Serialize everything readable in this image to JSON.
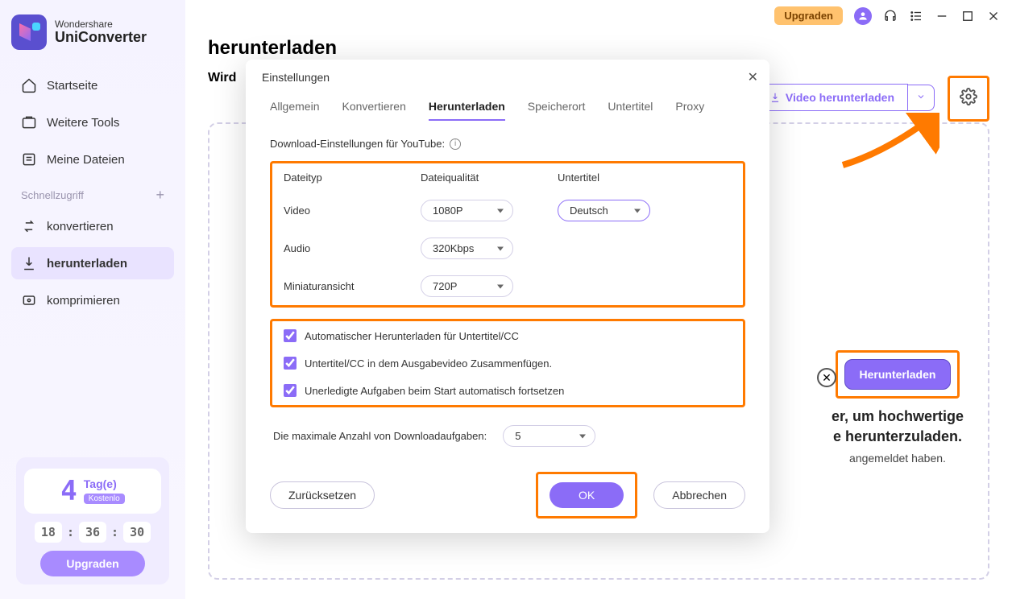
{
  "titlebar": {
    "upgrade": "Upgraden"
  },
  "brand": {
    "top": "Wondershare",
    "bottom": "UniConverter"
  },
  "nav": {
    "home": "Startseite",
    "tools": "Weitere Tools",
    "files": "Meine Dateien",
    "quick_label": "Schnellzugriff",
    "convert": "konvertieren",
    "download": "herunterladen",
    "compress": "komprimieren"
  },
  "trial": {
    "num": "4",
    "days": "Tag(e)",
    "free": "Kostenlo",
    "h": "18",
    "m": "36",
    "s": "30",
    "upgrade": "Upgraden"
  },
  "page": {
    "title": "herunterladen",
    "sub": "Wird"
  },
  "dlbtn": {
    "label": "Video herunterladen"
  },
  "promo": {
    "btn": "Herunterladen",
    "line1": "er, um hochwertige",
    "line2": "e herunterzuladen.",
    "sub": "angemeldet haben."
  },
  "modal": {
    "title": "Einstellungen",
    "tabs": {
      "general": "Allgemein",
      "convert": "Konvertieren",
      "download": "Herunterladen",
      "storage": "Speicherort",
      "subtitle": "Untertitel",
      "proxy": "Proxy"
    },
    "hint": "Download-Einstellungen für YouTube:",
    "headers": {
      "filetype": "Dateityp",
      "quality": "Dateiqualität",
      "subtitle": "Untertitel"
    },
    "rows": {
      "video": {
        "label": "Video",
        "quality": "1080P",
        "subtitle": "Deutsch"
      },
      "audio": {
        "label": "Audio",
        "quality": "320Kbps"
      },
      "thumb": {
        "label": "Miniaturansicht",
        "quality": "720P"
      }
    },
    "checks": {
      "c1": "Automatischer Herunterladen für Untertitel/CC",
      "c2": "Untertitel/CC in dem Ausgabevideo Zusammenfügen.",
      "c3": "Unerledigte Aufgaben beim Start automatisch fortsetzen"
    },
    "max_label": "Die maximale Anzahl von Downloadaufgaben:",
    "max_value": "5",
    "reset": "Zurücksetzen",
    "ok": "OK",
    "cancel": "Abbrechen"
  }
}
